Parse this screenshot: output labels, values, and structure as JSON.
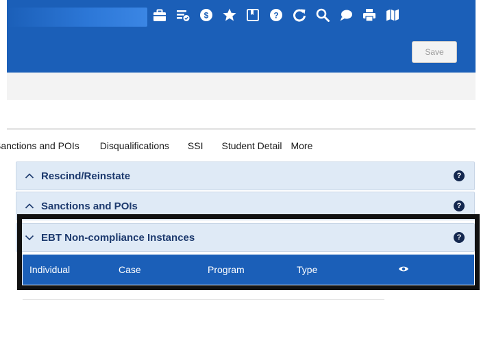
{
  "header": {
    "save_label": "Save",
    "icons": [
      "briefcase-icon",
      "task-list-icon",
      "dollar-coin-icon",
      "star-icon",
      "bookmark-icon",
      "help-icon",
      "refresh-icon",
      "search-icon",
      "chat-icon",
      "print-icon",
      "map-icon"
    ],
    "background_color": "#1b5fb8"
  },
  "tabs": [
    {
      "label": "Sanctions and POIs"
    },
    {
      "label": "Disqualifications"
    },
    {
      "label": "SSI"
    },
    {
      "label": "Student Detail"
    },
    {
      "label": "More"
    }
  ],
  "sections": [
    {
      "title": "Rescind/Reinstate",
      "expanded": false,
      "help": "?"
    },
    {
      "title": "Sanctions and POIs",
      "expanded": false,
      "help": "?"
    },
    {
      "title": "EBT Non-compliance Instances",
      "expanded": true,
      "help": "?"
    }
  ],
  "table": {
    "columns": [
      "Individual",
      "Case",
      "Program",
      "Type"
    ],
    "visibility_icon": "eye-icon"
  },
  "colors": {
    "accent": "#1b5fb8",
    "section_background": "#dfeaf6",
    "section_text": "#1d3a6e",
    "highlight_frame": "#111111"
  }
}
